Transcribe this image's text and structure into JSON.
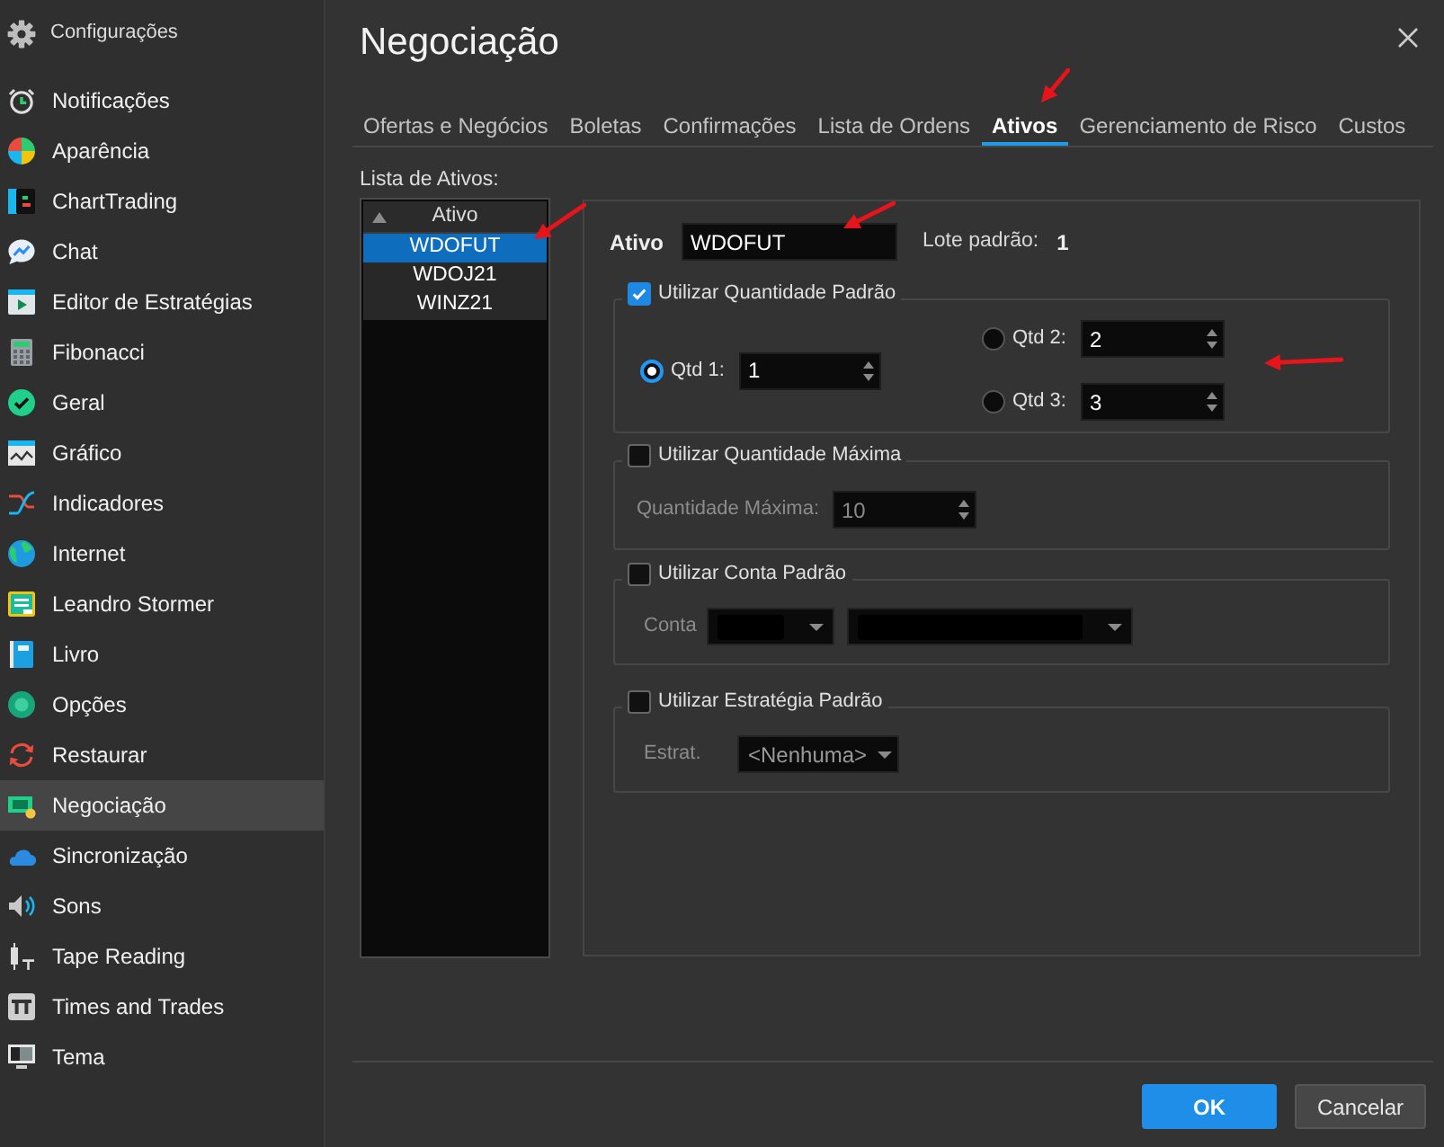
{
  "sidebar": {
    "title": "Configurações",
    "items": [
      {
        "label": "Notificações",
        "selected": false
      },
      {
        "label": "Aparência",
        "selected": false
      },
      {
        "label": "ChartTrading",
        "selected": false
      },
      {
        "label": "Chat",
        "selected": false
      },
      {
        "label": "Editor de Estratégias",
        "selected": false
      },
      {
        "label": "Fibonacci",
        "selected": false
      },
      {
        "label": "Geral",
        "selected": false
      },
      {
        "label": "Gráfico",
        "selected": false
      },
      {
        "label": "Indicadores",
        "selected": false
      },
      {
        "label": "Internet",
        "selected": false
      },
      {
        "label": "Leandro Stormer",
        "selected": false
      },
      {
        "label": "Livro",
        "selected": false
      },
      {
        "label": "Opções",
        "selected": false
      },
      {
        "label": "Restaurar",
        "selected": false
      },
      {
        "label": "Negociação",
        "selected": true
      },
      {
        "label": "Sincronização",
        "selected": false
      },
      {
        "label": "Sons",
        "selected": false
      },
      {
        "label": "Tape Reading",
        "selected": false
      },
      {
        "label": "Times and Trades",
        "selected": false
      },
      {
        "label": "Tema",
        "selected": false
      }
    ]
  },
  "dialog": {
    "title": "Negociação"
  },
  "tabs": [
    {
      "label": "Ofertas e Negócios",
      "selected": false
    },
    {
      "label": "Boletas",
      "selected": false
    },
    {
      "label": "Confirmações",
      "selected": false
    },
    {
      "label": "Lista de Ordens",
      "selected": false
    },
    {
      "label": "Ativos",
      "selected": true
    },
    {
      "label": "Gerenciamento de Risco",
      "selected": false
    },
    {
      "label": "Custos",
      "selected": false
    }
  ],
  "asset_list": {
    "label": "Lista de Ativos:",
    "column": "Ativo",
    "rows": [
      {
        "symbol": "WDOFUT",
        "selected": true
      },
      {
        "symbol": "WDOJ21",
        "selected": false
      },
      {
        "symbol": "WINZ21",
        "selected": false
      }
    ]
  },
  "asset_field": {
    "label": "Ativo",
    "value": "WDOFUT"
  },
  "default_lot": {
    "label": "Lote padrão:",
    "value": "1"
  },
  "groups": [
    {
      "kind": "quantities",
      "label": "Utilizar Quantidade Padrão",
      "checked": true,
      "options": [
        {
          "label": "Qtd 1:",
          "value": "1",
          "selected": true
        },
        {
          "label": "Qtd 2:",
          "value": "2",
          "selected": false
        },
        {
          "label": "Qtd 3:",
          "value": "3",
          "selected": false
        }
      ]
    },
    {
      "kind": "spin",
      "label": "Utilizar Quantidade Máxima",
      "checked": false,
      "field_label": "Quantidade Máxima:",
      "value": "10"
    },
    {
      "kind": "account",
      "label": "Utilizar Conta Padrão",
      "checked": false,
      "field_label": "Conta",
      "combos": [
        {
          "redacted": true
        },
        {
          "redacted": true
        }
      ]
    },
    {
      "kind": "strategy",
      "label": "Utilizar Estratégia Padrão",
      "checked": false,
      "field_label": "Estrat.",
      "combos": [
        {
          "value": "<Nenhuma>"
        }
      ]
    }
  ],
  "buttons": [
    {
      "label": "OK",
      "kind": "primary"
    },
    {
      "label": "Cancelar",
      "kind": "secondary"
    }
  ]
}
